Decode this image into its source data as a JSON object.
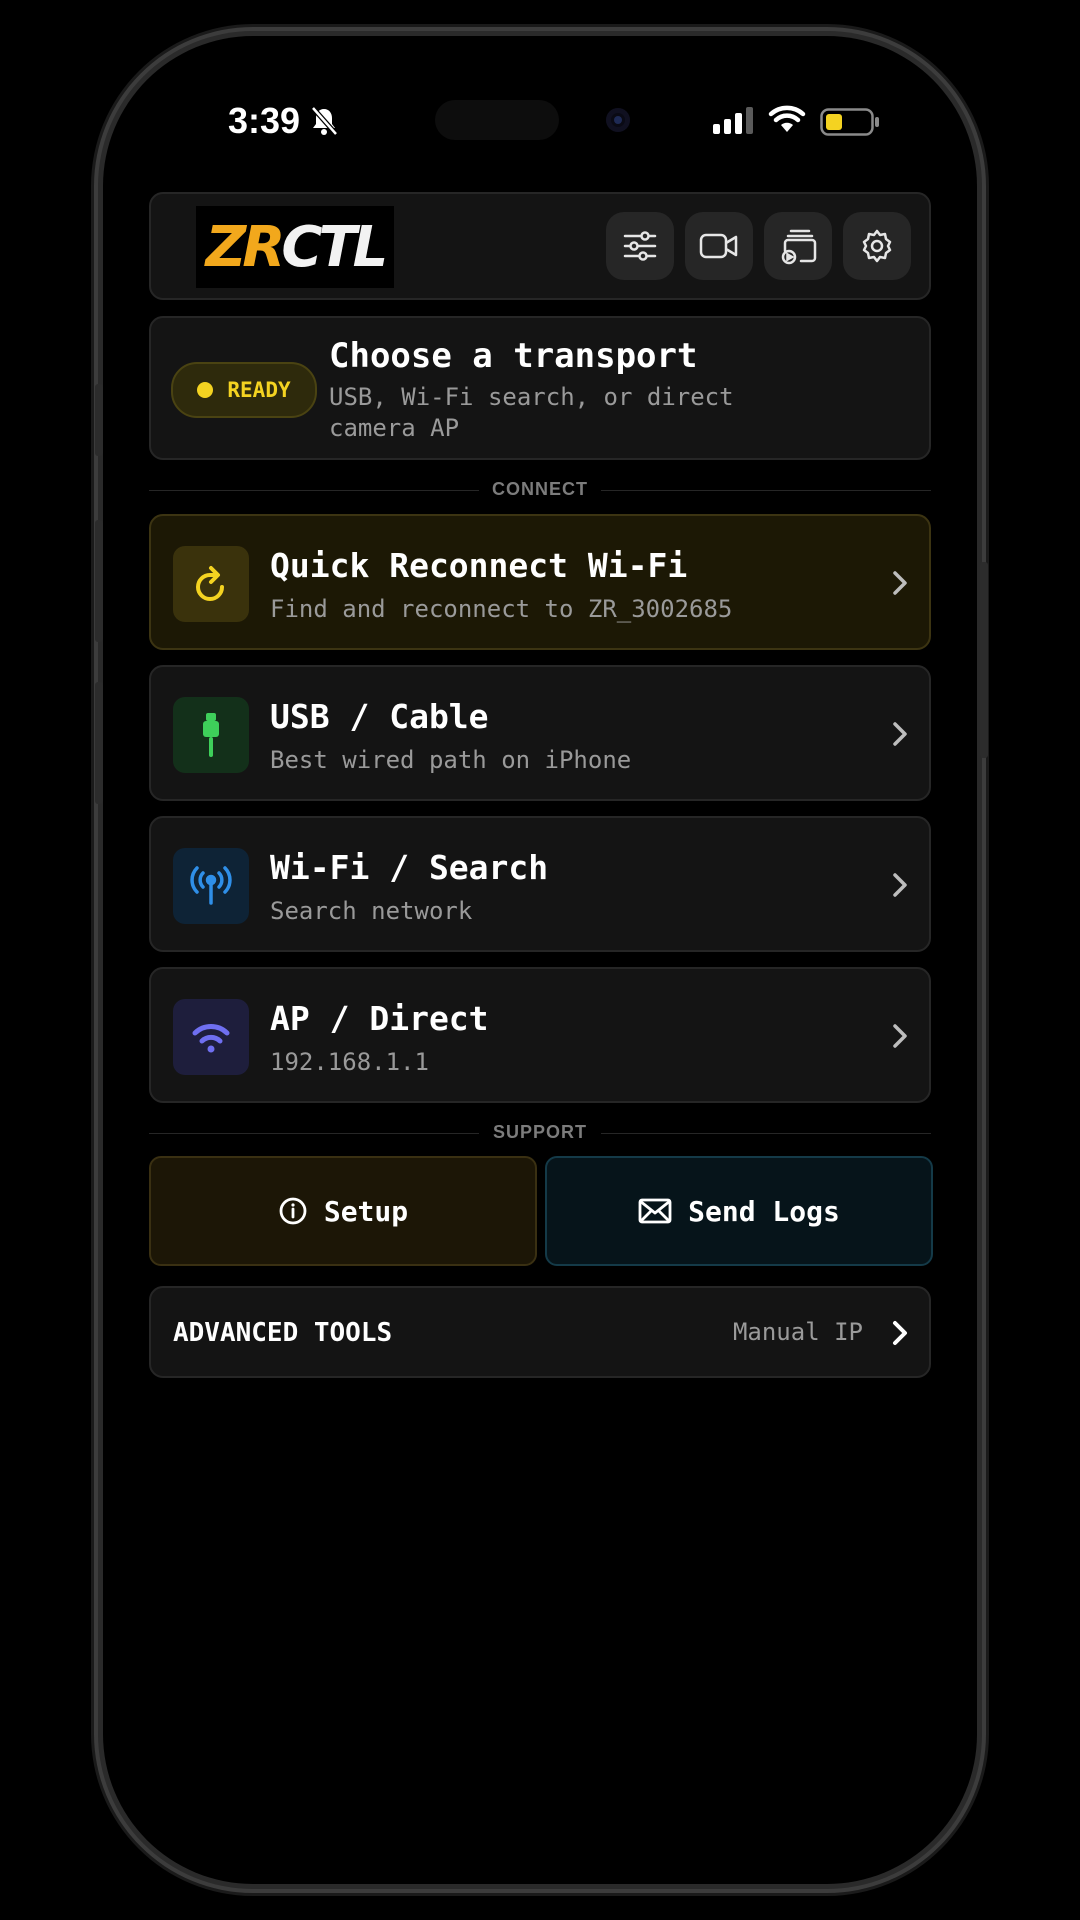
{
  "status_bar": {
    "time": "3:39"
  },
  "header": {
    "logo_zr": "ZR",
    "logo_ctl": "CTL",
    "buttons": [
      "sliders-icon",
      "video-camera-icon",
      "cast-icon",
      "gear-icon"
    ]
  },
  "ready": {
    "badge": "READY",
    "title": "Choose a transport",
    "subtitle": "USB, Wi-Fi search, or direct camera AP"
  },
  "sections": {
    "connect": "CONNECT",
    "support": "SUPPORT"
  },
  "transports": [
    {
      "title": "Quick Reconnect Wi-Fi",
      "subtitle": "Find and reconnect to ZR_3002685",
      "icon": "refresh-icon",
      "accent": "#f4d321"
    },
    {
      "title": "USB / Cable",
      "subtitle": "Best wired path on iPhone",
      "icon": "usb-cable-icon",
      "accent": "#3ecf5a"
    },
    {
      "title": "Wi-Fi / Search",
      "subtitle": "Search network",
      "icon": "antenna-icon",
      "accent": "#2f8fe8"
    },
    {
      "title": "AP / Direct",
      "subtitle": "192.168.1.1",
      "icon": "wifi-icon",
      "accent": "#6f6ff0"
    }
  ],
  "support": {
    "setup": "Setup",
    "send_logs": "Send Logs"
  },
  "advanced": {
    "title": "ADVANCED TOOLS",
    "right": "Manual IP"
  }
}
